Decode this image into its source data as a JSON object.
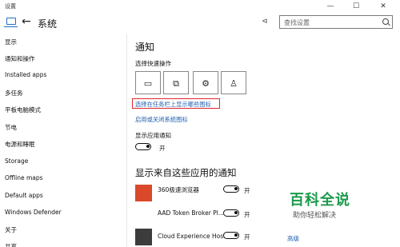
{
  "window": {
    "title": "设置",
    "minimize": "—",
    "maximize": "☐",
    "close": "✕"
  },
  "header": {
    "back_glyph": "←",
    "title": "系统",
    "pin_glyph": "⊲",
    "search_placeholder": "查找设置"
  },
  "sidebar": {
    "items": [
      {
        "label": "显示"
      },
      {
        "label": "通知和操作"
      },
      {
        "label": "Installed apps"
      },
      {
        "label": "多任务"
      },
      {
        "label": "平板电脑模式"
      },
      {
        "label": "节电"
      },
      {
        "label": "电源和睡眠"
      },
      {
        "label": "Storage"
      },
      {
        "label": "Offline maps"
      },
      {
        "label": "Default apps"
      },
      {
        "label": "Windows Defender"
      },
      {
        "label": "关于"
      },
      {
        "label": "共享"
      }
    ]
  },
  "main": {
    "notifications_heading": "通知",
    "quick_actions_label": "选择快速操作",
    "quick_actions": [
      {
        "icon": "tablet-mode-icon",
        "glyph": "▭"
      },
      {
        "icon": "connect-icon",
        "glyph": "⧉"
      },
      {
        "icon": "settings-icon",
        "glyph": "⚙"
      },
      {
        "icon": "vpn-icon",
        "glyph": "♙"
      }
    ],
    "taskbar_icons_link": "选择在任务栏上显示哪些图标",
    "system_icons_link": "启用或关闭系统图标",
    "show_app_notifications_label": "显示应用通知",
    "show_app_notifications_state": "开",
    "app_notifications_heading": "显示来自这些应用的通知",
    "apps": [
      {
        "name": "360极速浏览器",
        "state": "开",
        "icon_color": "#d9492a"
      },
      {
        "name": "AAD Token Broker Pl...",
        "state": "开",
        "icon_color": ""
      },
      {
        "name": "Cloud Experience Host",
        "state": "开",
        "icon_color": "#3c3c3c"
      }
    ],
    "advanced_link": "高级"
  },
  "watermark": {
    "brand": "百科全说",
    "tagline": "助你轻松解决"
  }
}
